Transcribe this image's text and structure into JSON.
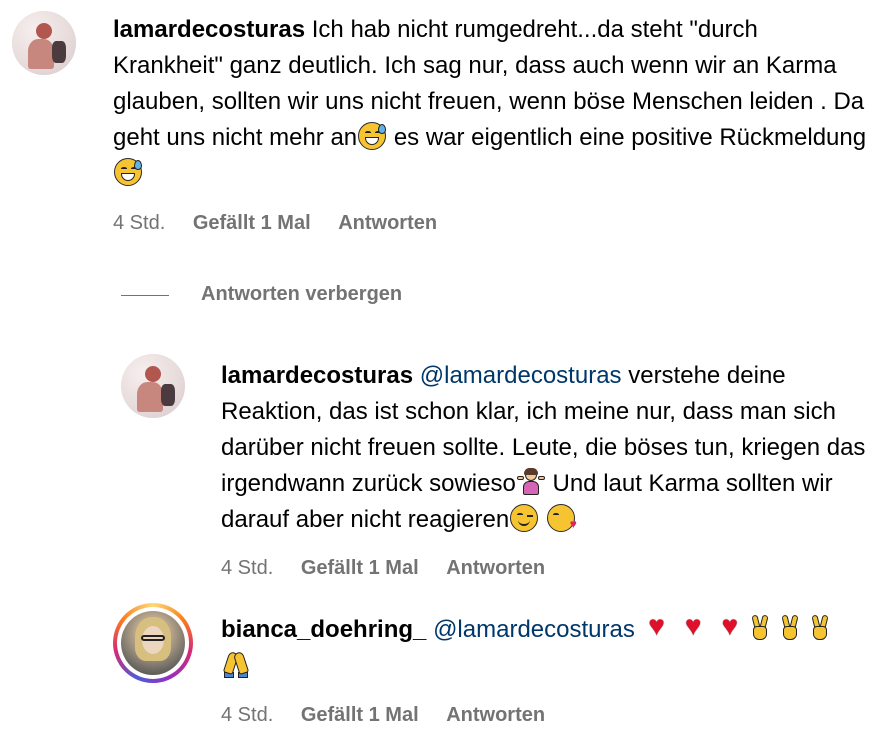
{
  "comments": [
    {
      "username": "lamardecosturas",
      "text_part1": "Ich hab nicht rumgedreht...da steht \"durch Krankheit\" ganz deutlich. Ich sag nur, dass auch wenn wir an Karma glauben, sollten wir uns nicht freuen, wenn böse Menschen leiden . Da geht uns nicht mehr an",
      "text_part2": " es war eigentlich eine positive Rückmeldung",
      "emojis": [
        "grinning-sweat-face",
        "grinning-sweat-face"
      ],
      "time": "4 Std.",
      "likes": "Gefällt 1 Mal",
      "reply": "Antworten"
    }
  ],
  "hide_replies": "Antworten verbergen",
  "replies": [
    {
      "username": "lamardecosturas",
      "mention": "@lamardecosturas",
      "text_part1": " verstehe deine Reaktion, das ist schon klar, ich meine nur, dass man sich darüber nicht freuen sollte. Leute, die böses tun, kriegen das irgendwann zurück sowieso",
      "text_part2": " Und laut Karma sollten wir darauf aber nicht reagieren",
      "emojis": [
        "person-shrugging",
        "winking-face",
        "face-blowing-kiss"
      ],
      "time": "4 Std.",
      "likes": "Gefällt 1 Mal",
      "reply": "Antworten"
    },
    {
      "username": "bianca_doehring_",
      "mention": "@lamardecosturas",
      "emojis": [
        "red-heart",
        "red-heart",
        "red-heart",
        "victory-hand",
        "victory-hand",
        "victory-hand",
        "folded-hands"
      ],
      "time": "4 Std.",
      "likes": "Gefällt 1 Mal",
      "reply": "Antworten"
    }
  ],
  "colors": {
    "mention": "#00376b",
    "meta": "#737373",
    "story_ring": [
      "#feda75",
      "#fa7e1e",
      "#d62976",
      "#962fbf",
      "#4f5bd5"
    ]
  }
}
